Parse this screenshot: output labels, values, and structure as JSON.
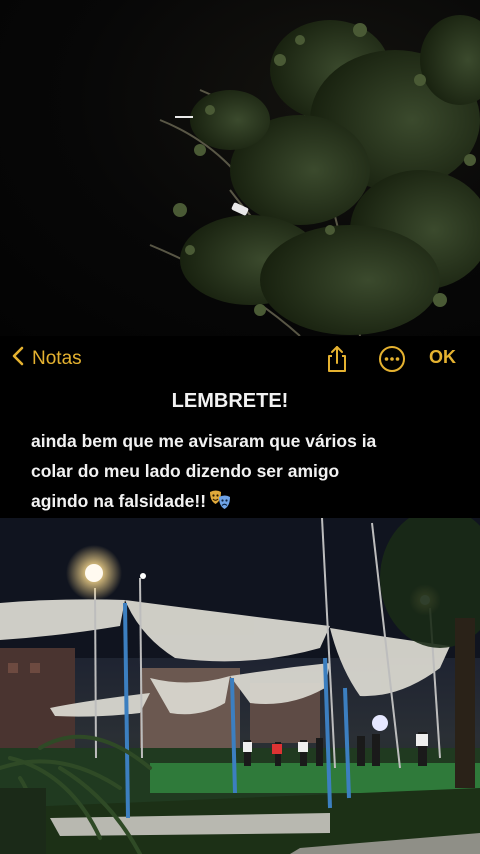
{
  "nav": {
    "back_label": "Notas",
    "ok_label": "OK",
    "accent_color": "#e5b230",
    "back_icon": "chevron-left-icon",
    "share_icon": "share-icon",
    "more_icon": "more-circle-icon"
  },
  "note": {
    "title": "LEMBRETE!",
    "lines": [
      "ainda bem que me avisaram que vários ia",
      "colar do meu lado dizendo ser amigo",
      "agindo na falsidade!!"
    ],
    "emoji_icon": "theater-masks-icon"
  },
  "photos": {
    "top": "night-sky-tree-photo",
    "bottom": "park-field-tent-photo"
  }
}
